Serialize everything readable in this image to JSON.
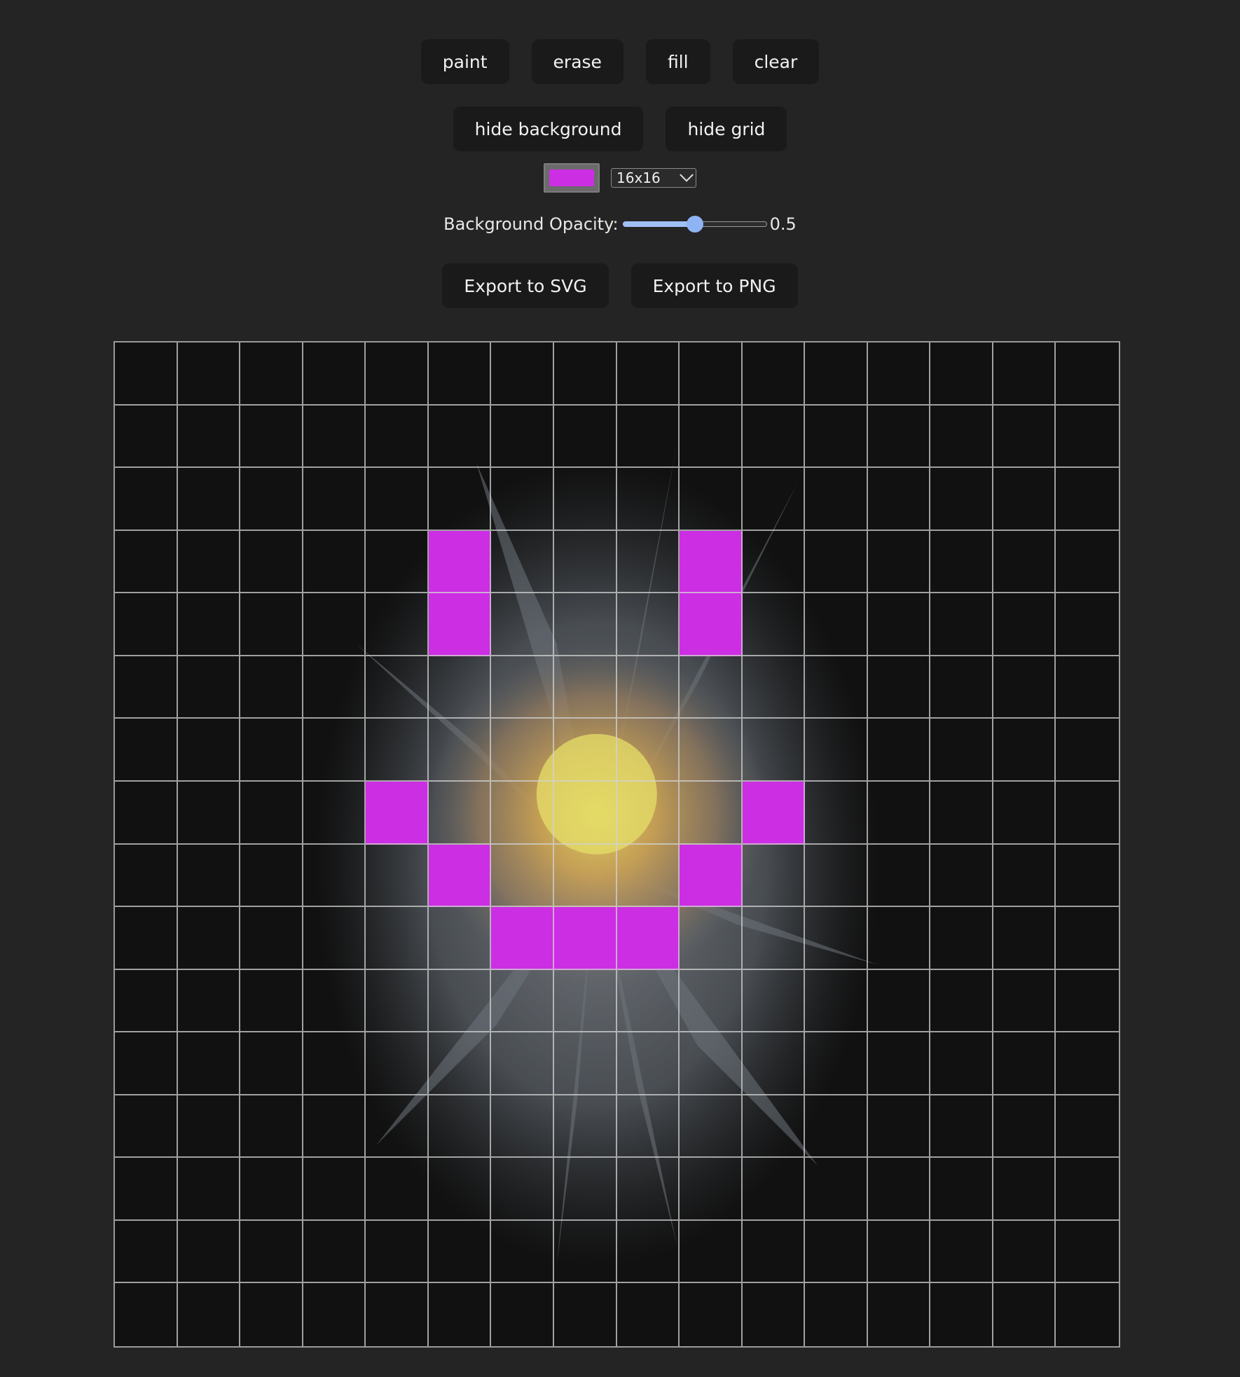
{
  "toolbar": {
    "paint_label": "paint",
    "erase_label": "erase",
    "fill_label": "fill",
    "clear_label": "clear"
  },
  "toggles": {
    "hide_background_label": "hide background",
    "hide_grid_label": "hide grid"
  },
  "settings": {
    "color": "#cc2ee3",
    "grid_size": "16x16",
    "grid_size_options": [
      "16x16"
    ]
  },
  "opacity": {
    "label": "Background Opacity:",
    "value": "0.5",
    "fraction": 0.5
  },
  "export": {
    "svg_label": "Export to SVG",
    "png_label": "Export to PNG"
  },
  "canvas": {
    "columns": 16,
    "rows": 16,
    "background_image": "dahlia-flower",
    "paint_color": "#cc2ee3",
    "painted_cells": [
      [
        3,
        5
      ],
      [
        4,
        5
      ],
      [
        3,
        9
      ],
      [
        4,
        9
      ],
      [
        7,
        4
      ],
      [
        7,
        10
      ],
      [
        8,
        5
      ],
      [
        8,
        9
      ],
      [
        9,
        6
      ],
      [
        9,
        7
      ],
      [
        9,
        8
      ]
    ]
  }
}
